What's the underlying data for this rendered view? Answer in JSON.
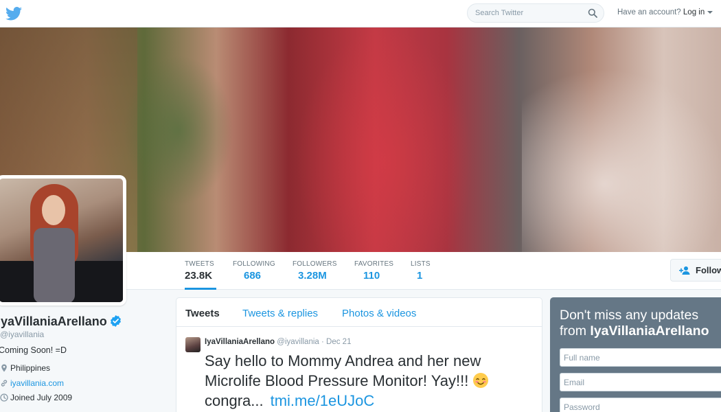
{
  "topbar": {
    "search_placeholder": "Search Twitter",
    "account_prompt": "Have an account?",
    "login_label": "Log in"
  },
  "nav": {
    "stats": [
      {
        "label": "TWEETS",
        "value": "23.8K"
      },
      {
        "label": "FOLLOWING",
        "value": "686"
      },
      {
        "label": "FOLLOWERS",
        "value": "3.28M"
      },
      {
        "label": "FAVORITES",
        "value": "110"
      },
      {
        "label": "LISTS",
        "value": "1"
      }
    ],
    "follow_label": "Follow"
  },
  "profile": {
    "name": "IyaVillaniaArellano",
    "handle": "@iyavillania",
    "bio": "Coming Soon! =D",
    "location": "Philippines",
    "url": "iyavillania.com",
    "joined": "Joined July 2009"
  },
  "timeline": {
    "tabs": [
      "Tweets",
      "Tweets & replies",
      "Photos & videos"
    ],
    "tweet": {
      "name": "IyaVillaniaArellano",
      "handle": "@iyavillania",
      "date": "· Dec 21",
      "text_line": "Say hello to Mommy Andrea and her new Microlife Blood Pressure Monitor! Yay!!!",
      "text_tail": "congra...",
      "link": "tmi.me/1eUJoC"
    }
  },
  "signup": {
    "heading_prefix": "Don't miss any updates from",
    "heading_name": "IyaVillaniaArellano",
    "fullname_placeholder": "Full name",
    "email_placeholder": "Email",
    "password_placeholder": "Password"
  },
  "colors": {
    "accent": "#1b95e0",
    "verified": "#1da1f2",
    "signup_bg": "#657786"
  }
}
